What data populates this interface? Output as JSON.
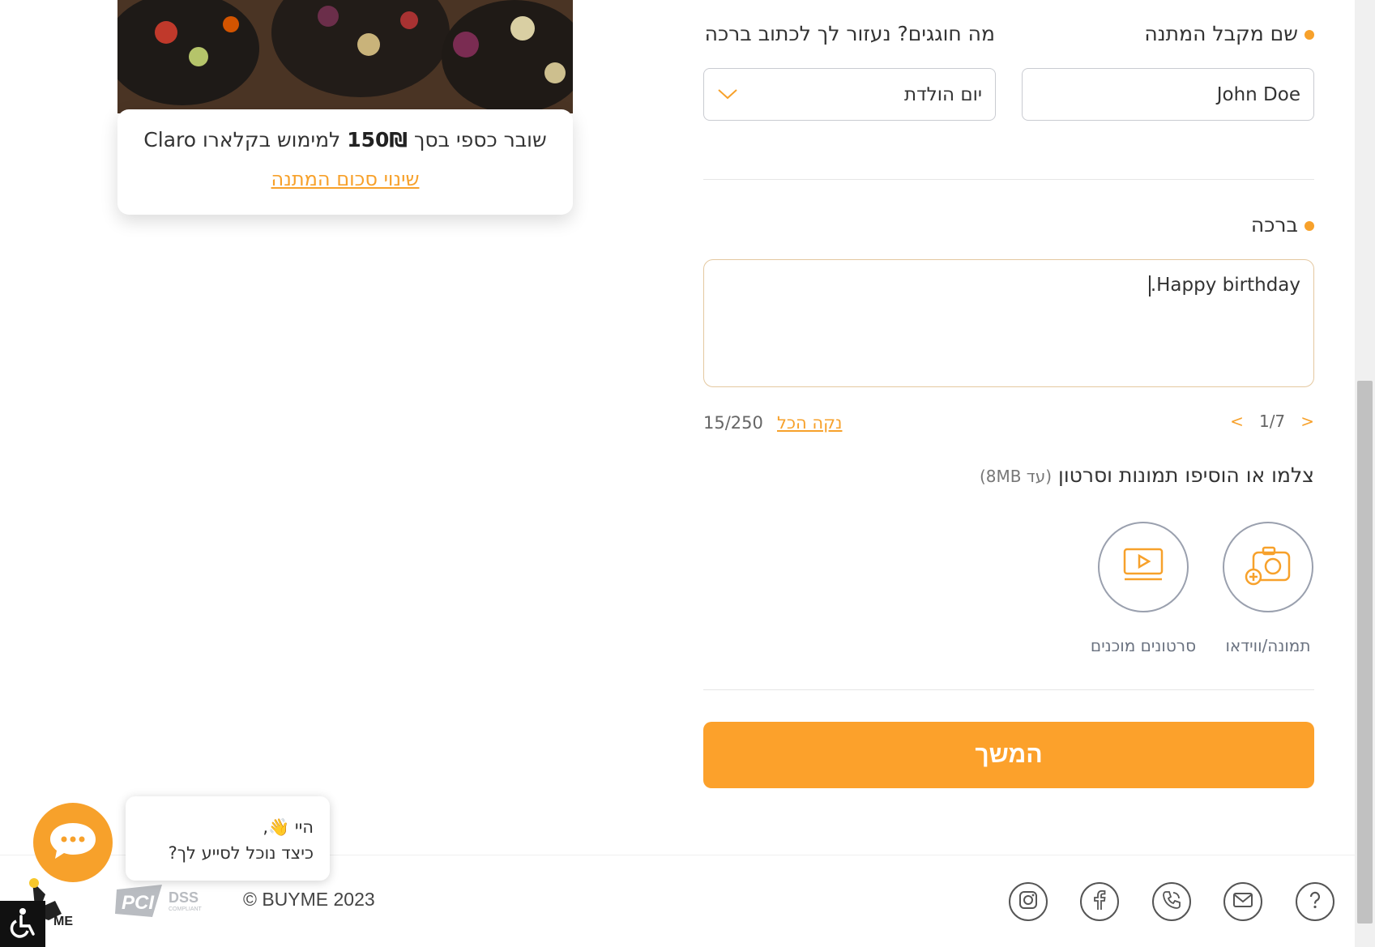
{
  "gift": {
    "desc_prefix": "שובר כספי בסך ",
    "amount": "150₪",
    "desc_suffix": " למימוש בקלארו Claro",
    "change_link": "שינוי סכום המתנה"
  },
  "form": {
    "recipient_label": "שם מקבל המתנה",
    "recipient_value": "John Doe",
    "occasion_label": "מה חוגגים? נעזור לך לכתוב ברכה",
    "occasion_value": "יום הולדת",
    "greeting_label": "ברכה",
    "greeting_value": "Happy birthday.",
    "clear_all": "נקה הכל",
    "char_counter": "15/250",
    "pager": "1/7",
    "pager_prev": "<",
    "pager_next": ">",
    "media_title": "צלמו או הוסיפו תמונות וסרטון",
    "media_limit": "(עד 8MB)",
    "media_photo_label": "תמונה/ווידאו",
    "media_video_label": "סרטונים מוכנים",
    "continue_label": "המשך"
  },
  "footer": {
    "copyright": "© BUYME 2023",
    "pci_label": "PCI DSS",
    "brand": "BUYME"
  },
  "chat": {
    "greeting": "היי 👋,",
    "question": "כיצד נוכל לסייע לך?"
  },
  "colors": {
    "accent": "#f7a12b",
    "button": "#fca12b",
    "text": "#333333"
  }
}
